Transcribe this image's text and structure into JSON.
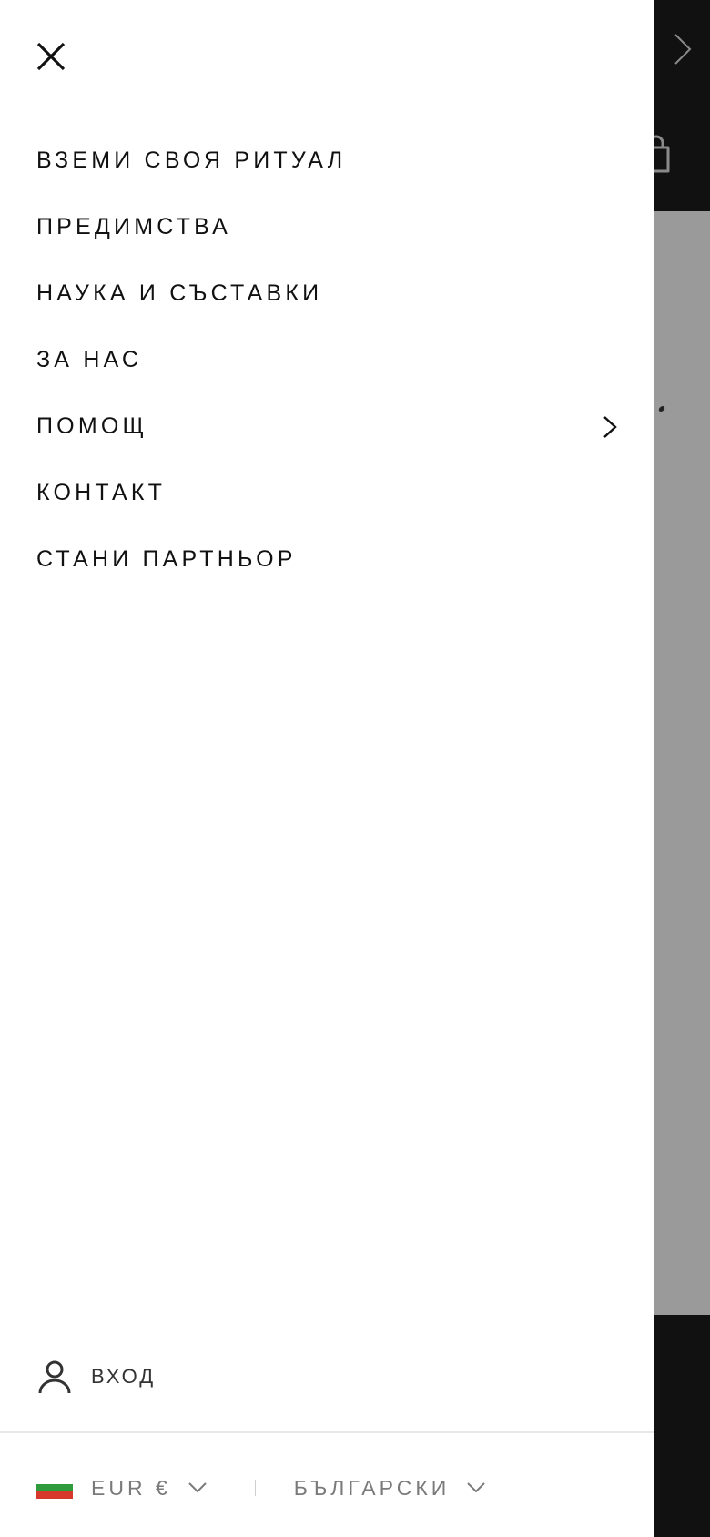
{
  "colors": {
    "drawer_bg": "#ffffff",
    "text": "#111111",
    "muted_text": "#7a7a7a",
    "overlay_dark": "#111111",
    "overlay_gray": "#9a9a9a",
    "flag_white": "#ffffff",
    "flag_green": "#2e9b3c",
    "flag_red": "#d6392c"
  },
  "icons": {
    "close": "close-icon",
    "submenu": "chevron-right-icon",
    "user": "user-icon",
    "dropdown": "chevron-down-icon",
    "bag": "shopping-bag-icon",
    "flag": "bulgaria-flag-icon"
  },
  "menu": {
    "items": [
      {
        "label": "ВЗЕМИ СВОЯ РИТУАЛ",
        "has_submenu": false
      },
      {
        "label": "ПРЕДИМСТВА",
        "has_submenu": false
      },
      {
        "label": "НАУКА И СЪСТАВКИ",
        "has_submenu": false
      },
      {
        "label": "ЗА НАС",
        "has_submenu": false
      },
      {
        "label": "ПОМОЩ",
        "has_submenu": true
      },
      {
        "label": "КОНТАКТ",
        "has_submenu": false
      },
      {
        "label": "СТАНИ ПАРТНЬОР",
        "has_submenu": false
      }
    ]
  },
  "account": {
    "login_label": "ВХОД"
  },
  "footer": {
    "currency": "EUR €",
    "language": "БЪЛГАРСКИ"
  }
}
